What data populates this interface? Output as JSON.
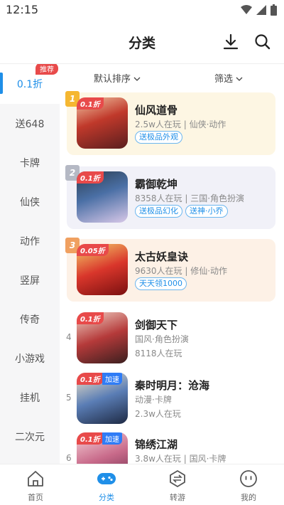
{
  "status": {
    "time": "12:15"
  },
  "header": {
    "title": "分类",
    "download_icon": "download-icon",
    "search_icon": "search-icon"
  },
  "sidebar": {
    "badge": "推荐",
    "items": [
      "0.1折",
      "送648",
      "卡牌",
      "仙侠",
      "动作",
      "竖屏",
      "传奇",
      "小游戏",
      "挂机",
      "二次元"
    ]
  },
  "filters": {
    "sort": "默认排序",
    "filter": "筛选"
  },
  "games": [
    {
      "rank": "1",
      "discount": "0.1折",
      "name": "仙风道骨",
      "meta": "2.5w人在玩 | 仙侠·动作",
      "tags": [
        "送极品外观"
      ]
    },
    {
      "rank": "2",
      "discount": "0.1折",
      "name": "霸御乾坤",
      "meta": "8358人在玩 | 三国·角色扮演",
      "tags": [
        "送极品幻化",
        "送神·小乔"
      ]
    },
    {
      "rank": "3",
      "discount": "0.05折",
      "name": "太古妖皇诀",
      "meta": "9630人在玩 | 修仙·动作",
      "tags": [
        "天天领1000"
      ]
    },
    {
      "rank": "4",
      "discount": "0.1折",
      "name": "剑御天下",
      "meta1": "国风·角色扮演",
      "meta2": "8118人在玩"
    },
    {
      "rank": "5",
      "discount": "0.1折",
      "accel": "加速",
      "name": "秦时明月：沧海",
      "meta1": "动漫·卡牌",
      "meta2": "2.3w人在玩"
    },
    {
      "rank": "6",
      "discount": "0.1折",
      "accel": "加速",
      "name": "锦绣江湖",
      "meta": "3.8w人在玩 | 国风·卡牌"
    }
  ],
  "tabs": [
    "首页",
    "分类",
    "转游",
    "我的"
  ],
  "colors": {
    "accent": "#1f8fe8",
    "rank1": "#f5b731",
    "rank2": "#b5b9c4",
    "rank3": "#f0a060"
  }
}
